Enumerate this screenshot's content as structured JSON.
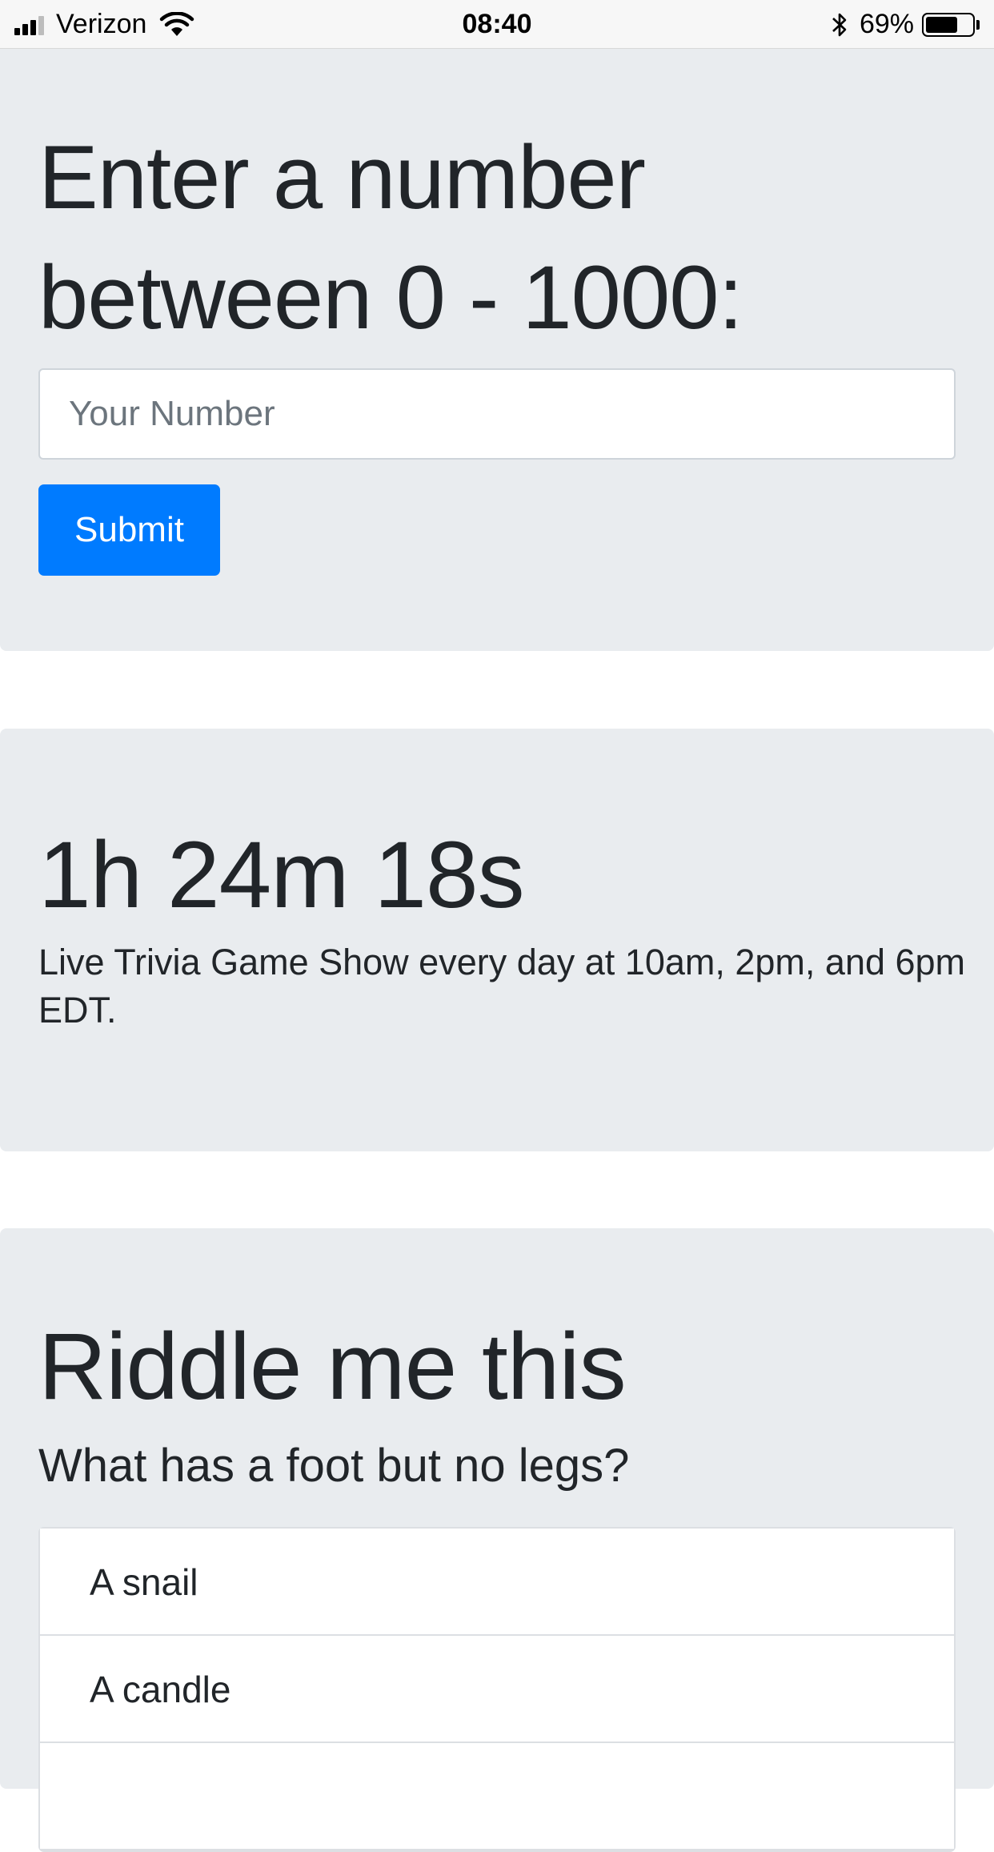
{
  "status_bar": {
    "carrier": "Verizon",
    "time": "08:40",
    "battery_percent": "69%",
    "battery_level": 0.69,
    "icons": [
      "signal-icon",
      "wifi-icon",
      "bluetooth-icon",
      "battery-icon"
    ]
  },
  "number_section": {
    "heading": "Enter a number between 0 - 1000:",
    "input_placeholder": "Your Number",
    "input_value": "",
    "submit_label": "Submit"
  },
  "countdown_section": {
    "countdown": "1h 24m 18s",
    "description": "Live Trivia Game Show every day at 10am, 2pm, and 6pm EDT."
  },
  "riddle_section": {
    "title": "Riddle me this",
    "question": "What has a foot but no legs?",
    "answers": [
      "A snail",
      "A candle",
      ""
    ]
  },
  "colors": {
    "panel_background": "#e9ecef",
    "primary_button": "#007bff",
    "text": "#212529"
  }
}
